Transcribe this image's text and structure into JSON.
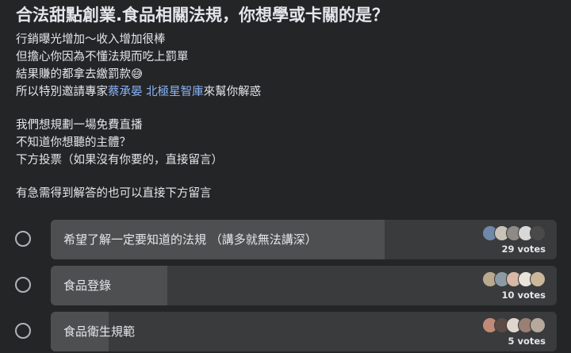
{
  "post": {
    "title": "合法甜點創業.食品相關法規，你想學或卡關的是？",
    "lines": [
      "行銷曝光增加～收入增加很棒",
      "但擔心你因為不懂法規而吃上罰單",
      "結果賺的都拿去繳罰款😅",
      "所以特別邀請專家",
      "我們想規劃一場免費直播",
      "不知道你想聽的主體？",
      "下方投票（如果沒有你要的，直接留言）",
      "有急需得到解答的也可以直接下方留言"
    ],
    "mention": "蔡承晏 北極星智庫",
    "line4_suffix": "來幫你解惑"
  },
  "poll": {
    "options": [
      {
        "label": "希望了解一定要知道的法規 （講多就無法講深）",
        "votes": "29 votes",
        "fill": 0.66
      },
      {
        "label": "食品登錄",
        "votes": "10 votes",
        "fill": 0.23
      },
      {
        "label": "食品衛生規範",
        "votes": "5 votes",
        "fill": 0.115
      }
    ]
  },
  "colors": {
    "background": "#242526",
    "bar": "#3a3b3c",
    "bar_fill": "#4e4f50",
    "mention": "#8ab4f8"
  }
}
